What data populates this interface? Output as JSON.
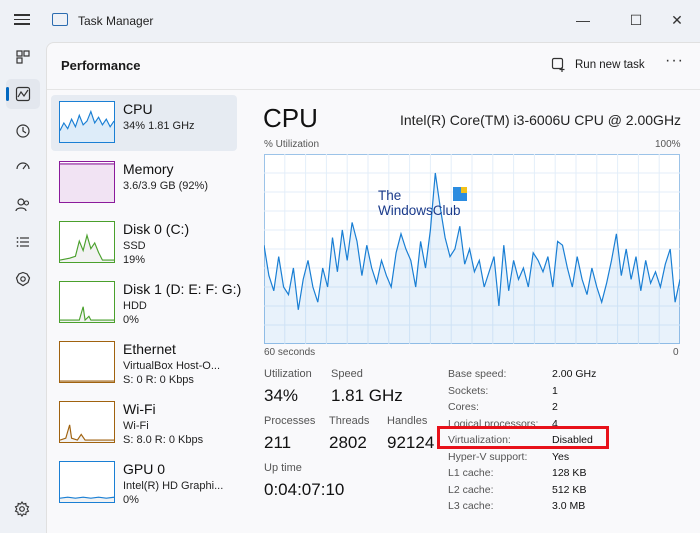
{
  "window": {
    "title": "Task Manager",
    "icon": "task-manager-icon"
  },
  "header": {
    "title": "Performance",
    "run_new_task": "Run new task",
    "more": "···"
  },
  "nav": [
    "processes-icon",
    "performance-icon",
    "app-history-icon",
    "startup-apps-icon",
    "users-icon",
    "details-icon",
    "services-icon",
    "settings-icon"
  ],
  "resources": [
    {
      "name": "CPU",
      "line2": "34%  1.81 GHz",
      "line3": "",
      "color": "#1a7fd4"
    },
    {
      "name": "Memory",
      "line2": "3.6/3.9 GB (92%)",
      "line3": "",
      "color": "#8b1a9b"
    },
    {
      "name": "Disk 0 (C:)",
      "line2": "SSD",
      "line3": "19%",
      "color": "#4aa02c"
    },
    {
      "name": "Disk 1 (D: E: F: G:)",
      "line2": "HDD",
      "line3": "0%",
      "color": "#4aa02c"
    },
    {
      "name": "Ethernet",
      "line2": "VirtualBox Host-O...",
      "line3": "S: 0  R: 0 Kbps",
      "color": "#a0620f"
    },
    {
      "name": "Wi-Fi",
      "line2": "Wi-Fi",
      "line3": "S: 8.0  R: 0 Kbps",
      "color": "#a0620f"
    },
    {
      "name": "GPU 0",
      "line2": "Intel(R) HD Graphi...",
      "line3": "0%",
      "color": "#1a7fd4"
    }
  ],
  "detail": {
    "title": "CPU",
    "model": "Intel(R) Core(TM) i3-6006U CPU @ 2.00GHz",
    "graph_label": "% Utilization",
    "graph_max": "100%",
    "graph_time": "60 seconds",
    "graph_min": "0",
    "watermark_line1": "The",
    "watermark_line2": "WindowsClub",
    "utilization_label": "Utilization",
    "utilization": "34%",
    "speed_label": "Speed",
    "speed": "1.81 GHz",
    "processes_label": "Processes",
    "processes": "211",
    "threads_label": "Threads",
    "threads": "2802",
    "handles_label": "Handles",
    "handles": "92124",
    "uptime_label": "Up time",
    "uptime": "0:04:07:10",
    "properties": [
      {
        "k": "Base speed:",
        "v": "2.00 GHz"
      },
      {
        "k": "Sockets:",
        "v": "1"
      },
      {
        "k": "Cores:",
        "v": "2"
      },
      {
        "k": "Logical processors:",
        "v": "4"
      },
      {
        "k": "Virtualization:",
        "v": "Disabled"
      },
      {
        "k": "Hyper-V support:",
        "v": "Yes"
      },
      {
        "k": "L1 cache:",
        "v": "128 KB"
      },
      {
        "k": "L2 cache:",
        "v": "512 KB"
      },
      {
        "k": "L3 cache:",
        "v": "3.0 MB"
      }
    ],
    "cpu_history": [
      52,
      36,
      28,
      46,
      30,
      26,
      40,
      18,
      34,
      44,
      30,
      22,
      40,
      30,
      56,
      38,
      60,
      44,
      64,
      54,
      36,
      52,
      40,
      32,
      44,
      36,
      30,
      48,
      58,
      50,
      44,
      30,
      54,
      40,
      60,
      90,
      72,
      56,
      46,
      50,
      62,
      42,
      50,
      38,
      44,
      30,
      38,
      46,
      20,
      52,
      28,
      44,
      34,
      40,
      30,
      48,
      44,
      38,
      46,
      30,
      54,
      52,
      40,
      30,
      46,
      34,
      26,
      40,
      30,
      22,
      32,
      44,
      58,
      36,
      50,
      34,
      46,
      28,
      44,
      32,
      38,
      30,
      42,
      50,
      22,
      34
    ]
  },
  "colors": {
    "accent": "#0067c0",
    "cpu": "#1a7fd4",
    "highlight": "#e8111a"
  }
}
